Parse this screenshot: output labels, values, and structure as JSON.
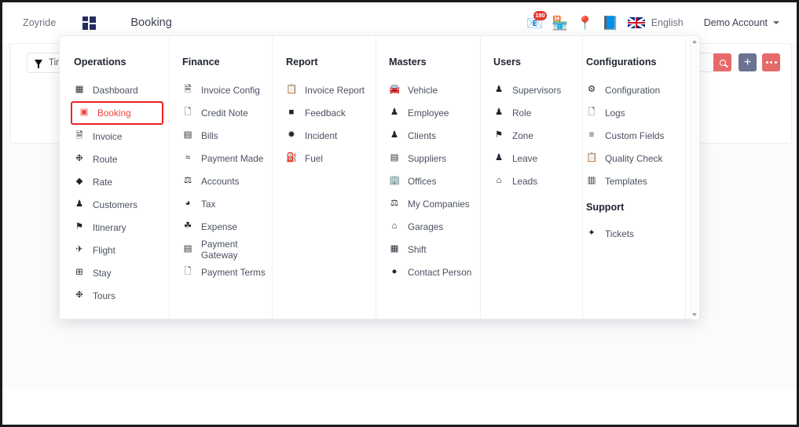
{
  "navbar": {
    "brand": "Zoyride",
    "logo_icon": "grid-logo-icon",
    "page_title": "Booking",
    "icons": [
      {
        "name": "mail-icon",
        "glyph": "📧",
        "badge": "180"
      },
      {
        "name": "store-icon",
        "glyph": "🏪",
        "badge": ""
      },
      {
        "name": "map-pin-icon",
        "glyph": "📍",
        "badge": ""
      },
      {
        "name": "info-book-icon",
        "glyph": "📘",
        "badge": ""
      }
    ],
    "language": "English",
    "language_flag": "uk-flag-icon",
    "account": "Demo Account",
    "account_caret": "chevron-down-icon"
  },
  "toolbar": {
    "filter_icon": "funnel-icon",
    "filter_label": "Tir",
    "search_value": "",
    "search_placeholder": "",
    "search_icon": "search-icon",
    "add_icon": "plus-icon",
    "more_icon": "ellipsis-icon"
  },
  "menu": {
    "active_item": "Booking",
    "active_color": "#f1453d",
    "columns": [
      {
        "title": "Operations",
        "items": [
          {
            "label": "Dashboard",
            "icon": "dashboard-icon",
            "glyph": "⌸",
            "active": false
          },
          {
            "label": "Booking",
            "icon": "ticket-icon",
            "glyph": "▣",
            "active": true
          },
          {
            "label": "Invoice",
            "icon": "invoice-icon",
            "glyph": "὜E",
            "active": false
          },
          {
            "label": "Route",
            "icon": "route-icon",
            "glyph": "☄",
            "active": false
          },
          {
            "label": "Rate",
            "icon": "tag-icon",
            "glyph": "◆",
            "active": false
          },
          {
            "label": "Customers",
            "icon": "users-icon",
            "glyph": "♟",
            "active": false
          },
          {
            "label": "Itinerary",
            "icon": "itinerary-icon",
            "glyph": "⚑",
            "active": false
          },
          {
            "label": "Flight",
            "icon": "plane-icon",
            "glyph": "✈",
            "active": false
          },
          {
            "label": "Stay",
            "icon": "hotel-icon",
            "glyph": "⊞",
            "active": false
          },
          {
            "label": "Tours",
            "icon": "tours-icon",
            "glyph": "☄",
            "active": false
          }
        ]
      },
      {
        "title": "Finance",
        "items": [
          {
            "label": "Invoice Config",
            "icon": "invoice-config-icon",
            "glyph": "὜E",
            "active": false
          },
          {
            "label": "Credit Note",
            "icon": "credit-note-icon",
            "glyph": "὜B",
            "active": false
          },
          {
            "label": "Bills",
            "icon": "bills-icon",
            "glyph": "▤",
            "active": false
          },
          {
            "label": "Payment Made",
            "icon": "payment-made-icon",
            "glyph": "≈",
            "active": false
          },
          {
            "label": "Accounts",
            "icon": "bank-icon",
            "glyph": "☖",
            "active": false
          },
          {
            "label": "Tax",
            "icon": "money-bag-icon",
            "glyph": "◕",
            "active": false
          },
          {
            "label": "Expense",
            "icon": "expense-icon",
            "glyph": "☘",
            "active": false
          },
          {
            "label": "Payment Gateway",
            "icon": "payment-gateway-icon",
            "glyph": "▤",
            "active": false
          },
          {
            "label": "Payment Terms",
            "icon": "payment-terms-icon",
            "glyph": "὜B",
            "active": false
          }
        ]
      },
      {
        "title": "Report",
        "items": [
          {
            "label": "Invoice Report",
            "icon": "clipboard-icon",
            "glyph": "ὌB",
            "active": false
          },
          {
            "label": "Feedback",
            "icon": "feedback-icon",
            "glyph": "■",
            "active": false
          },
          {
            "label": "Incident",
            "icon": "incident-icon",
            "glyph": "✹",
            "active": false
          },
          {
            "label": "Fuel",
            "icon": "fuel-icon",
            "glyph": "⛽",
            "active": false
          }
        ]
      },
      {
        "title": "Masters",
        "items": [
          {
            "label": "Vehicle",
            "icon": "car-icon",
            "glyph": "Ὡ7",
            "active": false
          },
          {
            "label": "Employee",
            "icon": "employee-icon",
            "glyph": "♟",
            "active": false
          },
          {
            "label": "Clients",
            "icon": "clients-icon",
            "glyph": "♟",
            "active": false
          },
          {
            "label": "Suppliers",
            "icon": "suppliers-icon",
            "glyph": "▤",
            "active": false
          },
          {
            "label": "Offices",
            "icon": "office-icon",
            "glyph": "Ἶ2",
            "active": false
          },
          {
            "label": "My Companies",
            "icon": "bank-icon",
            "glyph": "☖",
            "active": false
          },
          {
            "label": "Garages",
            "icon": "garage-icon",
            "glyph": "⌂",
            "active": false
          },
          {
            "label": "Shift",
            "icon": "calendar-icon",
            "glyph": "▦",
            "active": false
          },
          {
            "label": "Contact Person",
            "icon": "contact-person-icon",
            "glyph": "●",
            "active": false
          }
        ]
      },
      {
        "title": "Users",
        "items": [
          {
            "label": "Supervisors",
            "icon": "supervisor-icon",
            "glyph": "♟",
            "active": false
          },
          {
            "label": "Role",
            "icon": "role-icon",
            "glyph": "♟",
            "active": false
          },
          {
            "label": "Zone",
            "icon": "zone-icon",
            "glyph": "⚑",
            "active": false
          },
          {
            "label": "Leave",
            "icon": "leave-icon",
            "glyph": "♟",
            "active": false
          },
          {
            "label": "Leads",
            "icon": "leads-icon",
            "glyph": "⌂",
            "active": false
          }
        ]
      },
      {
        "title": "Configurations",
        "items": [
          {
            "label": "Configuration",
            "icon": "configuration-icon",
            "glyph": "⚙",
            "active": false
          },
          {
            "label": "Logs",
            "icon": "logs-icon",
            "glyph": "὜B",
            "active": false
          },
          {
            "label": "Custom Fields",
            "icon": "custom-fields-icon",
            "glyph": "≡",
            "active": false
          },
          {
            "label": "Quality Check",
            "icon": "quality-check-icon",
            "glyph": "ὌB",
            "active": false
          },
          {
            "label": "Templates",
            "icon": "templates-icon",
            "glyph": "▥",
            "active": false
          }
        ],
        "subtitle": "Support",
        "sub_items": [
          {
            "label": "Tickets",
            "icon": "tickets-icon",
            "glyph": "✦",
            "active": false
          }
        ]
      }
    ],
    "scrollbar": {
      "up_icon": "scroll-up-arrow-icon",
      "down_icon": "scroll-down-arrow-icon"
    }
  }
}
